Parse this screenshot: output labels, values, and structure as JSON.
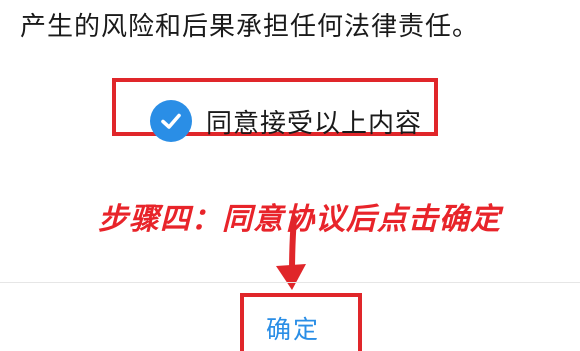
{
  "body_text": "产生的风险和后果承担任何法律责任。",
  "agreement": {
    "checked": true,
    "label": "同意接受以上内容"
  },
  "annotation": {
    "step_text": "步骤四：同意协议后点击确定"
  },
  "confirm_button": {
    "label": "确定"
  },
  "colors": {
    "accent_blue": "#2a8ee6",
    "highlight_red": "#e0262a"
  },
  "icons": {
    "checkbox": "check-circle-icon",
    "annotation": "arrow-down-icon"
  }
}
